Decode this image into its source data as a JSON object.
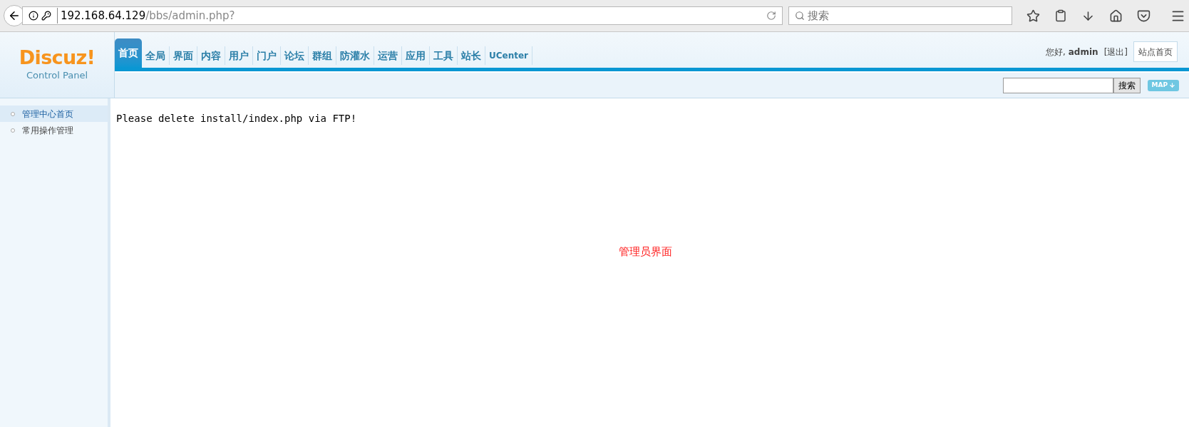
{
  "browser": {
    "url_host": "192.168.64.129",
    "url_path": "/bbs/admin.php?",
    "search_placeholder": "搜索"
  },
  "logo": {
    "title": "Discuz!",
    "subtitle": "Control Panel"
  },
  "nav": [
    {
      "label": "首页",
      "selected": true
    },
    {
      "label": "全局",
      "selected": false
    },
    {
      "label": "界面",
      "selected": false
    },
    {
      "label": "内容",
      "selected": false
    },
    {
      "label": "用户",
      "selected": false
    },
    {
      "label": "门户",
      "selected": false
    },
    {
      "label": "论坛",
      "selected": false
    },
    {
      "label": "群组",
      "selected": false
    },
    {
      "label": "防灌水",
      "selected": false
    },
    {
      "label": "运营",
      "selected": false
    },
    {
      "label": "应用",
      "selected": false
    },
    {
      "label": "工具",
      "selected": false
    },
    {
      "label": "站长",
      "selected": false
    },
    {
      "label": "UCenter",
      "selected": false
    }
  ],
  "user": {
    "greeting": "您好,",
    "name": "admin",
    "logout": "[退出]",
    "home_button": "站点首页"
  },
  "search": {
    "button": "搜索",
    "map": "MAP"
  },
  "sidebar": [
    {
      "label": "管理中心首页",
      "selected": true
    },
    {
      "label": "常用操作管理",
      "selected": false
    }
  ],
  "message": "Please delete install/index.php via FTP!",
  "annotation": "管理员界面"
}
